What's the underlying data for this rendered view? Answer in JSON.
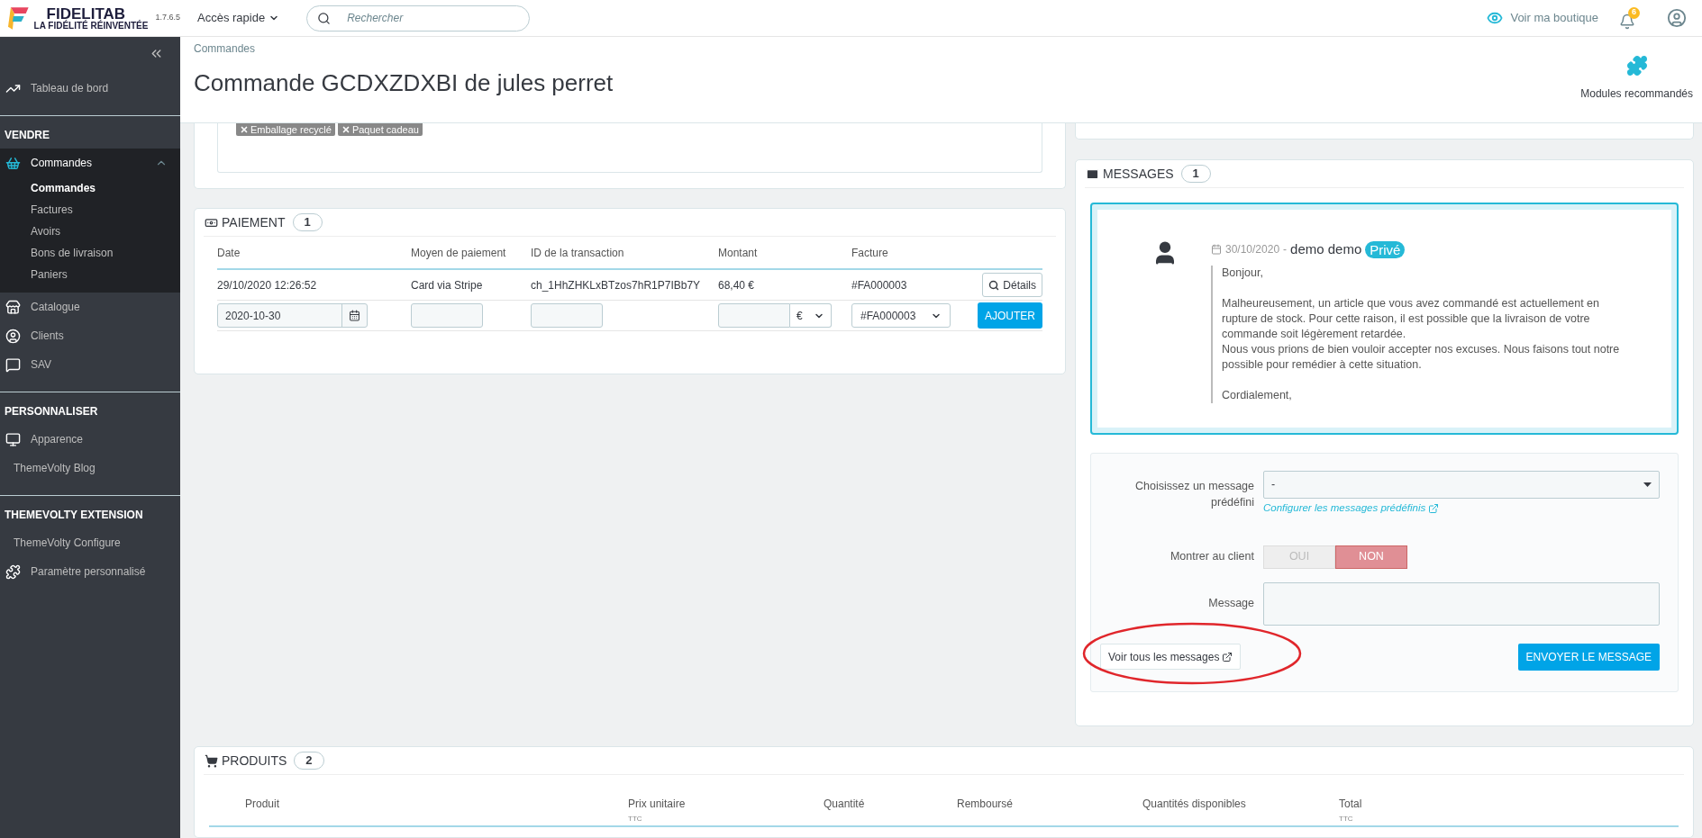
{
  "header": {
    "logo": {
      "name": "FIDELITAB",
      "tagline": "LA FIDÉLITÉ RÉINVENTÉE"
    },
    "version": "1.7.6.5",
    "quick_access": "Accès rapide",
    "search": {
      "placeholder": "Rechercher"
    },
    "shop_link": "Voir ma boutique",
    "notifications": "6"
  },
  "sidebar": {
    "sections": [
      {
        "items": [
          {
            "label": "Tableau de bord",
            "kind": "icon",
            "selected": false,
            "expanded": false
          }
        ]
      },
      {
        "title": "VENDRE",
        "items": [
          {
            "label": "Commandes",
            "kind": "icon",
            "selected": true,
            "expanded": true,
            "children": [
              {
                "label": "Commandes",
                "selected": true
              },
              {
                "label": "Factures",
                "selected": false
              },
              {
                "label": "Avoirs",
                "selected": false
              },
              {
                "label": "Bons de livraison",
                "selected": false
              },
              {
                "label": "Paniers",
                "selected": false
              }
            ]
          },
          {
            "label": "Catalogue",
            "kind": "icon",
            "selected": false,
            "expanded": false
          },
          {
            "label": "Clients",
            "kind": "icon",
            "selected": false,
            "expanded": false
          },
          {
            "label": "SAV",
            "kind": "icon",
            "selected": false,
            "expanded": false
          }
        ]
      },
      {
        "title": "PERSONNALISER",
        "items": [
          {
            "label": "Apparence",
            "kind": "icon",
            "selected": false,
            "expanded": false
          },
          {
            "label": "ThemeVolty Blog",
            "kind": "plain",
            "selected": false,
            "expanded": false
          }
        ]
      },
      {
        "title": "THEMEVOLTY EXTENSION",
        "items": [
          {
            "label": "ThemeVolty Configure",
            "kind": "plain",
            "selected": false,
            "expanded": false
          },
          {
            "label": "Paramètre personnalisé",
            "kind": "icon",
            "selected": false,
            "expanded": false
          }
        ]
      }
    ]
  },
  "page": {
    "breadcrumb": "Commandes",
    "title": "Commande GCDXZDXBI de jules perret",
    "toolbar_button": "Modules recommandés"
  },
  "tags": [
    "Emballage recyclé",
    "Paquet cadeau"
  ],
  "payment": {
    "title": "PAIEMENT",
    "count": "1",
    "columns": [
      "Date",
      "Moyen de paiement",
      "ID de la transaction",
      "Montant",
      "Facture"
    ],
    "rows": [
      {
        "date": "29/10/2020 12:26:52",
        "method": "Card via Stripe",
        "transaction": "ch_1HhZHKLxBTzos7hR1P7IBb7Y",
        "amount": "68,40 €",
        "invoice": "#FA000003",
        "button": "Détails"
      }
    ],
    "form": {
      "date": "2020-10-30",
      "currency": "€",
      "invoice": "#FA000003",
      "button": "AJOUTER"
    }
  },
  "messages": {
    "title": "MESSAGES",
    "count": "1",
    "message": {
      "date": "30/10/2020",
      "separator": "-",
      "author": "demo demo",
      "badge": "Privé",
      "paragraphs": [
        [
          "Bonjour,"
        ],
        [
          "Malheureusement, un article que vous avez commandé est actuellement en rupture de stock. Pour cette raison, il est possible que la livraison de votre commande soit légèrement retardée.",
          "Nous vous prions de bien vouloir accepter nos excuses. Nous faisons tout notre possible pour remédier à cette situation."
        ],
        [
          "Cordialement,"
        ]
      ]
    },
    "form": {
      "predefined_label": "Choisissez un message prédéfini",
      "predefined_value": "-",
      "config_link": "Configurer les messages prédéfinis",
      "show_label": "Montrer au client",
      "toggle": [
        {
          "label": "OUI",
          "selected": false
        },
        {
          "label": "NON",
          "selected": true
        }
      ],
      "message_label": "Message",
      "view_all": "Voir tous les messages",
      "send": "ENVOYER LE MESSAGE"
    }
  },
  "products": {
    "title": "PRODUITS",
    "count": "2",
    "columns": [
      {
        "label": "Produit"
      },
      {
        "label": "Prix unitaire",
        "sub": "TTC"
      },
      {
        "label": "Quantité"
      },
      {
        "label": "Remboursé"
      },
      {
        "label": "Quantités disponibles"
      },
      {
        "label": "Total",
        "sub": "TTC"
      }
    ]
  }
}
